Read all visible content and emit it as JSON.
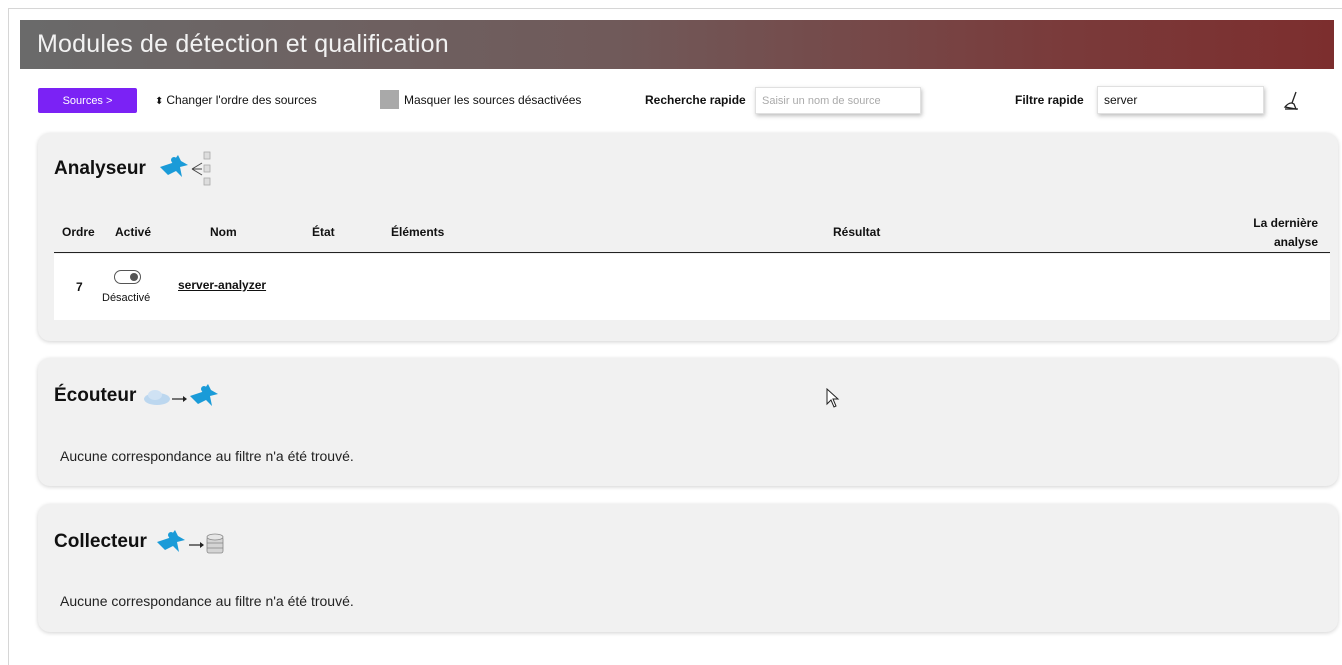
{
  "header": {
    "title": "Modules de détection et qualification"
  },
  "toolbar": {
    "sources_button": "Sources >",
    "order_link": "Changer l'ordre des sources",
    "order_icon": "sort-arrows-icon",
    "hide_disabled_label": "Masquer les sources désactivées",
    "quick_search_label": "Recherche rapide",
    "quick_search_placeholder": "Saisir un nom de source",
    "quick_search_value": "",
    "quick_filter_label": "Filtre rapide",
    "quick_filter_value": "server",
    "clear_icon": "broom-icon"
  },
  "analyseur": {
    "title": "Analyseur",
    "columns": {
      "ordre": "Ordre",
      "active": "Activé",
      "nom": "Nom",
      "etat": "État",
      "elements": "Éléments",
      "resultat": "Résultat",
      "derniere_1": "La dernière",
      "derniere_2": "analyse"
    },
    "rows": [
      {
        "ordre": "7",
        "active": false,
        "active_label": "Désactivé",
        "nom": "server-analyzer",
        "etat": "",
        "elements": "",
        "resultat": "",
        "derniere": ""
      }
    ]
  },
  "ecouteur": {
    "title": "Écouteur",
    "empty_message": "Aucune correspondance au filtre n'a été trouvé."
  },
  "collecteur": {
    "title": "Collecteur",
    "empty_message": "Aucune correspondance au filtre n'a été trouvé."
  },
  "colors": {
    "sources_button": "#7b22f5",
    "header_start": "#6a6a6a",
    "header_end": "#7c2e2e",
    "panel_bg": "#f1f1f1",
    "ninja_blue": "#1a9bd8"
  }
}
